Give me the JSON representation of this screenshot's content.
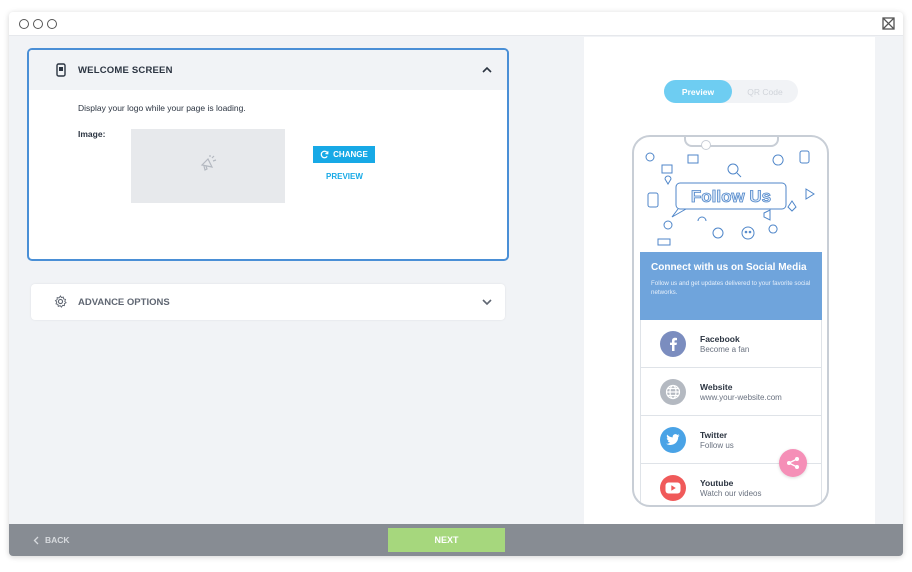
{
  "titlebar": {
    "close_icon": "close-window-icon"
  },
  "welcome": {
    "title": "WELCOME SCREEN",
    "description": "Display your logo while your page is loading.",
    "image_label": "Image:",
    "change_label": "CHANGE",
    "preview_label": "PREVIEW"
  },
  "advance": {
    "title": "ADVANCE OPTIONS"
  },
  "preview_toggle": {
    "preview": "Preview",
    "qr": "QR Code"
  },
  "phone": {
    "doodle_text": "Follow Us",
    "banner_title": "Connect with us on Social Media",
    "banner_text": "Follow us and get updates delivered to your favorite social networks.",
    "items": [
      {
        "title": "Facebook",
        "subtitle": "Become a fan",
        "color": "#7b8dbf",
        "icon": "facebook-icon"
      },
      {
        "title": "Website",
        "subtitle": "www.your-website.com",
        "color": "#b4b9c1",
        "icon": "globe-icon"
      },
      {
        "title": "Twitter",
        "subtitle": "Follow us",
        "color": "#4aa3e6",
        "icon": "twitter-icon"
      },
      {
        "title": "Youtube",
        "subtitle": "Watch our videos",
        "color": "#f05a5a",
        "icon": "youtube-icon"
      }
    ]
  },
  "footer": {
    "back_label": "BACK",
    "next_label": "NEXT"
  },
  "colors": {
    "accent": "#17a9e6",
    "next": "#a6d77d",
    "footer": "#878c93",
    "banner": "#6fa4dc"
  }
}
